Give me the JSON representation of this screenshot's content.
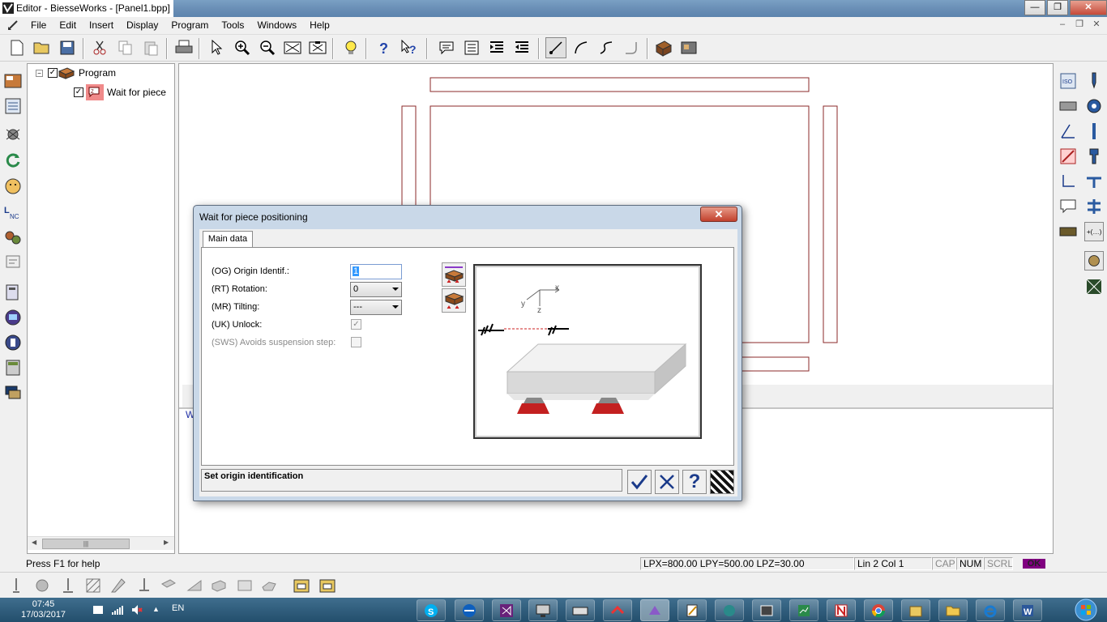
{
  "window": {
    "title": "Editor - BiesseWorks - [Panel1.bpp]",
    "minimize": "—",
    "maximize": "❐",
    "close": "✕"
  },
  "menu": {
    "items": [
      "File",
      "Edit",
      "Insert",
      "Display",
      "Program",
      "Tools",
      "Windows",
      "Help"
    ],
    "mdi_min": "–",
    "mdi_restore": "❐",
    "mdi_close": "✕"
  },
  "tree": {
    "root_label": "Program",
    "child_label": "Wait for piece",
    "expander": "−",
    "root_checked": "✓",
    "child_checked": "✓"
  },
  "editor": {
    "partial_text": "W"
  },
  "dialog": {
    "title": "Wait for piece positioning",
    "close": "✕",
    "tab": "Main data",
    "fields": {
      "origin_label": "(OG) Origin Identif.:",
      "origin_value": "1",
      "rotation_label": "(RT) Rotation:",
      "rotation_value": "0",
      "tilting_label": "(MR) Tilting:",
      "tilting_value": "---",
      "unlock_label": "(UK) Unlock:",
      "unlock_checked": "✓",
      "sws_label": "(SWS) Avoids suspension step:"
    },
    "preview": {
      "axis_x": "x",
      "axis_y": "y",
      "axis_z": "z"
    },
    "description": "Set origin identification",
    "help_glyph": "?"
  },
  "status": {
    "help": "Press F1 for help",
    "dimensions": "LPX=800.00  LPY=500.00  LPZ=30.00",
    "position": "Lin 2  Col 1",
    "cap": "CAP",
    "num": "NUM",
    "scrl": "SCRL",
    "ok": "OK"
  },
  "taskbar": {
    "time": "07:45",
    "date": "17/03/2017",
    "lang": "EN"
  },
  "colors": {
    "drawing_lines": "#8b2a2a",
    "selection_blue": "#3399ff",
    "title_bar": "#6a8fb6",
    "taskbar": "#2d5a7a"
  }
}
